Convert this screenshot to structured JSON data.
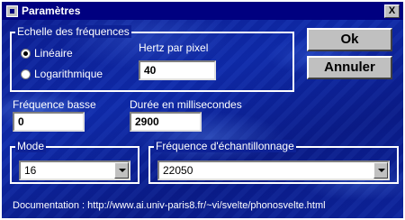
{
  "window": {
    "title": "Paramètres",
    "close_label": "X"
  },
  "scale_group": {
    "label": "Echelle des fréquences",
    "options": [
      {
        "label": "Linéaire",
        "checked": true
      },
      {
        "label": "Logarithmique",
        "checked": false
      }
    ],
    "hertz_label": "Hertz par pixel",
    "hertz_value": "40"
  },
  "buttons": {
    "ok": "Ok",
    "cancel": "Annuler"
  },
  "low_freq": {
    "label": "Fréquence basse",
    "value": "0"
  },
  "duration": {
    "label": "Durée en millisecondes",
    "value": "2900"
  },
  "mode": {
    "label": "Mode",
    "value": "16"
  },
  "sampling": {
    "label": "Fréquence d'échantillonnage",
    "value": "22050"
  },
  "documentation": "Documentation : http://www.ai.univ-paris8.fr/~vi/svelte/phonosvelte.html"
}
